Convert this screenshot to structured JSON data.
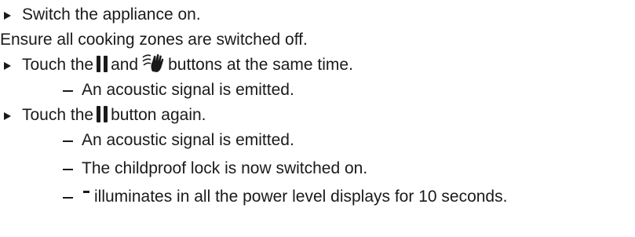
{
  "lines": [
    {
      "text": "Switch the appliance on."
    },
    {
      "text": "Ensure all cooking zones are switched off."
    },
    {
      "before": "Touch the",
      "middle": "and",
      "after": "buttons at the same time."
    },
    {
      "text": "An acoustic signal is emitted."
    },
    {
      "before": "Touch the",
      "after": "button again."
    },
    {
      "text": "An acoustic signal is emitted."
    },
    {
      "text": "The childproof lock is now switched on."
    },
    {
      "text": "illuminates in all the power level displays for 10 seconds."
    }
  ],
  "icons": {
    "bullet": "triangle-right-icon",
    "dash": "dash-icon",
    "pause": "pause-lock-icon",
    "hand": "hand-wave-icon",
    "display": "segment-minus-icon"
  }
}
